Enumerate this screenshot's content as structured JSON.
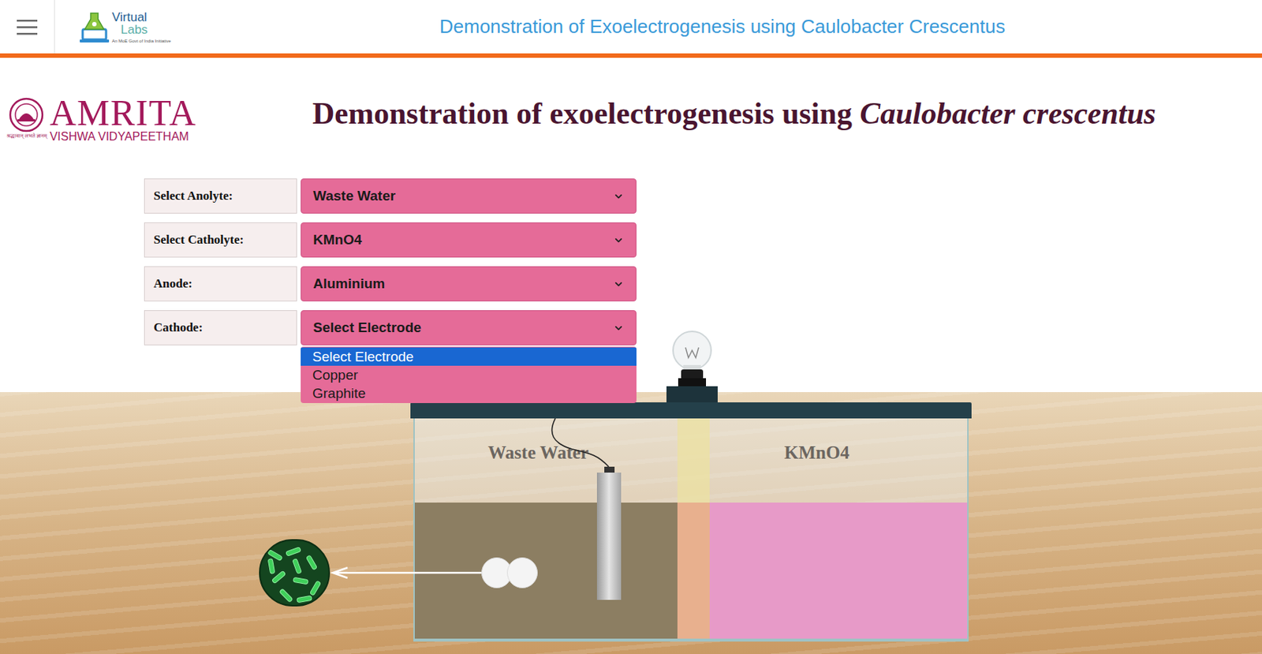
{
  "header": {
    "logo": {
      "line1": "Virtual",
      "line2": "Labs",
      "tagline": "An MoE Govt of India Initiative"
    },
    "title": "Demonstration of Exoelectrogenesis using Caulobacter Crescentus"
  },
  "brand": {
    "name": "AMRITA",
    "subtitle": "VISHWA VIDYAPEETHAM",
    "motto": "श्रद्धावान् लभते ज्ञानम्"
  },
  "heading": {
    "text": "Demonstration of exoelectrogenesis using ",
    "species": "Caulobacter crescentus"
  },
  "form": [
    {
      "label": "Select Anolyte:",
      "value": "Waste Water",
      "open": false
    },
    {
      "label": "Select Catholyte:",
      "value": "KMnO4",
      "open": false
    },
    {
      "label": "Anode:",
      "value": "Aluminium",
      "open": false
    },
    {
      "label": "Cathode:",
      "value": "Select Electrode",
      "open": true
    }
  ],
  "dropdown": {
    "options": [
      {
        "label": "Select Electrode",
        "selected": true
      },
      {
        "label": "Copper",
        "selected": false
      },
      {
        "label": "Graphite",
        "selected": false
      }
    ]
  },
  "tank": {
    "anolyte": "Waste Water",
    "catholyte": "KMnO4",
    "anode_inserted": true,
    "cathode_inserted": false,
    "bulb_lit": false
  }
}
